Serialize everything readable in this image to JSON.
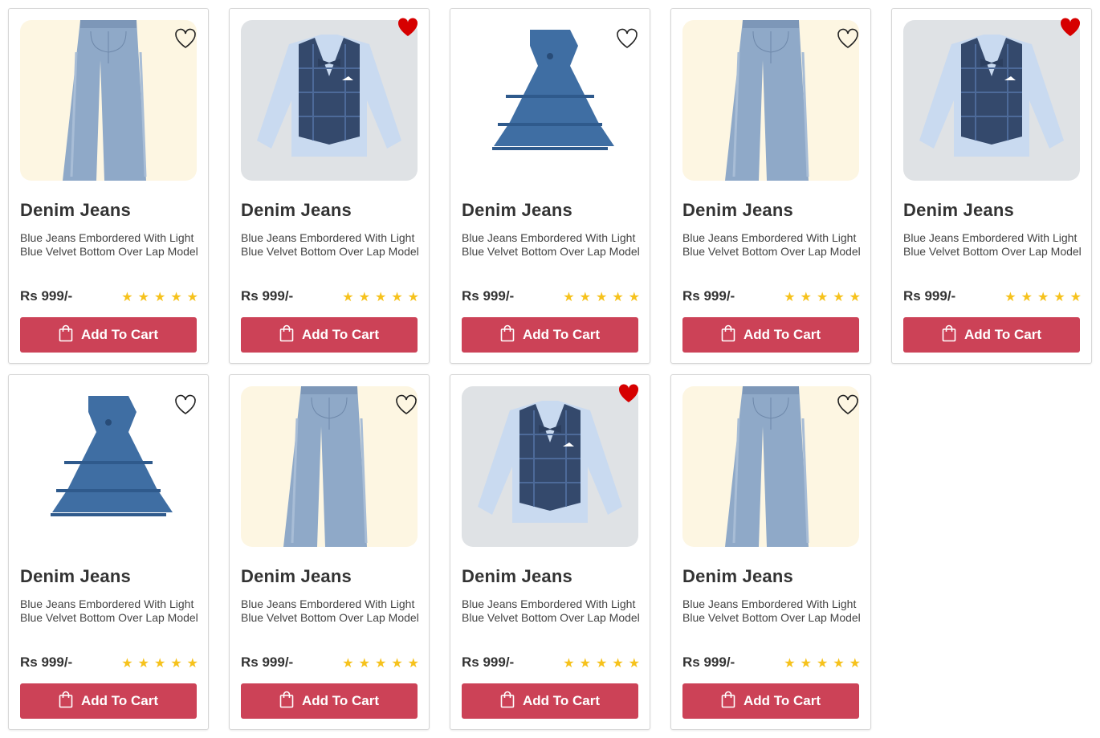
{
  "colors": {
    "button": "#cc4257",
    "star": "#f6c21c",
    "heart_active": "#d60000"
  },
  "products": [
    {
      "image": "jeans",
      "favorite": false,
      "title": "Denim Jeans",
      "description": "Blue Jeans Embordered With Light Blue Velvet Bottom Over Lap Model",
      "price": "Rs 999/-",
      "rating": 5,
      "cta": "Add To Cart"
    },
    {
      "image": "vest",
      "favorite": true,
      "title": "Denim Jeans",
      "description": "Blue Jeans Embordered With Light Blue Velvet Bottom Over Lap Model",
      "price": "Rs 999/-",
      "rating": 5,
      "cta": "Add To Cart"
    },
    {
      "image": "dress",
      "favorite": false,
      "title": "Denim Jeans",
      "description": "Blue Jeans Embordered With Light Blue Velvet Bottom Over Lap Model",
      "price": "Rs 999/-",
      "rating": 5,
      "cta": "Add To Cart"
    },
    {
      "image": "jeans",
      "favorite": false,
      "title": "Denim Jeans",
      "description": "Blue Jeans Embordered With Light Blue Velvet Bottom Over Lap Model",
      "price": "Rs 999/-",
      "rating": 5,
      "cta": "Add To Cart"
    },
    {
      "image": "vest",
      "favorite": true,
      "title": "Denim Jeans",
      "description": "Blue Jeans Embordered With Light Blue Velvet Bottom Over Lap Model",
      "price": "Rs 999/-",
      "rating": 5,
      "cta": "Add To Cart"
    },
    {
      "image": "dress",
      "favorite": false,
      "title": "Denim Jeans",
      "description": "Blue Jeans Embordered With Light Blue Velvet Bottom Over Lap Model",
      "price": "Rs 999/-",
      "rating": 5,
      "cta": "Add To Cart"
    },
    {
      "image": "jeans",
      "favorite": false,
      "title": "Denim Jeans",
      "description": "Blue Jeans Embordered With Light Blue Velvet Bottom Over Lap Model",
      "price": "Rs 999/-",
      "rating": 5,
      "cta": "Add To Cart"
    },
    {
      "image": "vest",
      "favorite": true,
      "title": "Denim Jeans",
      "description": "Blue Jeans Embordered With Light Blue Velvet Bottom Over Lap Model",
      "price": "Rs 999/-",
      "rating": 5,
      "cta": "Add To Cart"
    },
    {
      "image": "jeans",
      "favorite": false,
      "title": "Denim Jeans",
      "description": "Blue Jeans Embordered With Light Blue Velvet Bottom Over Lap Model",
      "price": "Rs 999/-",
      "rating": 5,
      "cta": "Add To Cart"
    }
  ]
}
